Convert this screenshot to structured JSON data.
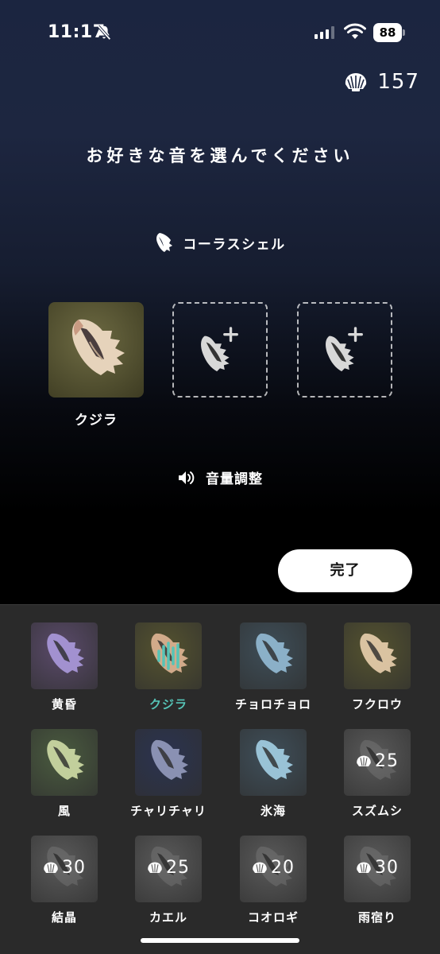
{
  "status_bar": {
    "time": "11:17",
    "battery": "88",
    "icons": [
      "bell-slash-icon",
      "cellular-signal-icon",
      "wifi-icon",
      "battery-icon"
    ]
  },
  "header": {
    "coin_count": "157",
    "coin_icon": "shell-coin-icon"
  },
  "page_title": "お好きな音を選んでください",
  "preset": {
    "icon": "conch-shell-icon",
    "name": "コーラスシェル"
  },
  "slots": [
    {
      "filled": true,
      "label": "クジラ",
      "icon": "conch-shell-icon"
    },
    {
      "filled": false,
      "icon": "add-shell-icon"
    },
    {
      "filled": false,
      "icon": "add-shell-icon"
    }
  ],
  "volume": {
    "icon": "speaker-icon",
    "label": "音量調整"
  },
  "done_button": "完了",
  "sounds": [
    {
      "label": "黄昏",
      "locked": false,
      "active": false,
      "color": "#5a4a6a"
    },
    {
      "label": "クジラ",
      "locked": false,
      "active": true,
      "color": "#55532f"
    },
    {
      "label": "チョロチョロ",
      "locked": false,
      "active": false,
      "color": "#3e4e58"
    },
    {
      "label": "フクロウ",
      "locked": false,
      "active": false,
      "color": "#55532f"
    },
    {
      "label": "風",
      "locked": false,
      "active": false,
      "color": "#4a5b3f"
    },
    {
      "label": "チャリチャリ",
      "locked": false,
      "active": false,
      "color": "#2b3350"
    },
    {
      "label": "氷海",
      "locked": false,
      "active": false,
      "color": "#3f4f5a"
    },
    {
      "label": "スズムシ",
      "locked": true,
      "price": "25",
      "active": false,
      "color": "#5a5a5a"
    },
    {
      "label": "結晶",
      "locked": true,
      "price": "30",
      "active": false,
      "color": "#5a5a5a"
    },
    {
      "label": "カエル",
      "locked": true,
      "price": "25",
      "active": false,
      "color": "#5a5a5a"
    },
    {
      "label": "コオロギ",
      "locked": true,
      "price": "20",
      "active": false,
      "color": "#5a5a5a"
    },
    {
      "label": "雨宿り",
      "locked": true,
      "price": "30",
      "active": false,
      "color": "#5a5a5a"
    }
  ],
  "colors": {
    "active_label": "#56c4b7",
    "panel_background": "#2a2a2a"
  }
}
